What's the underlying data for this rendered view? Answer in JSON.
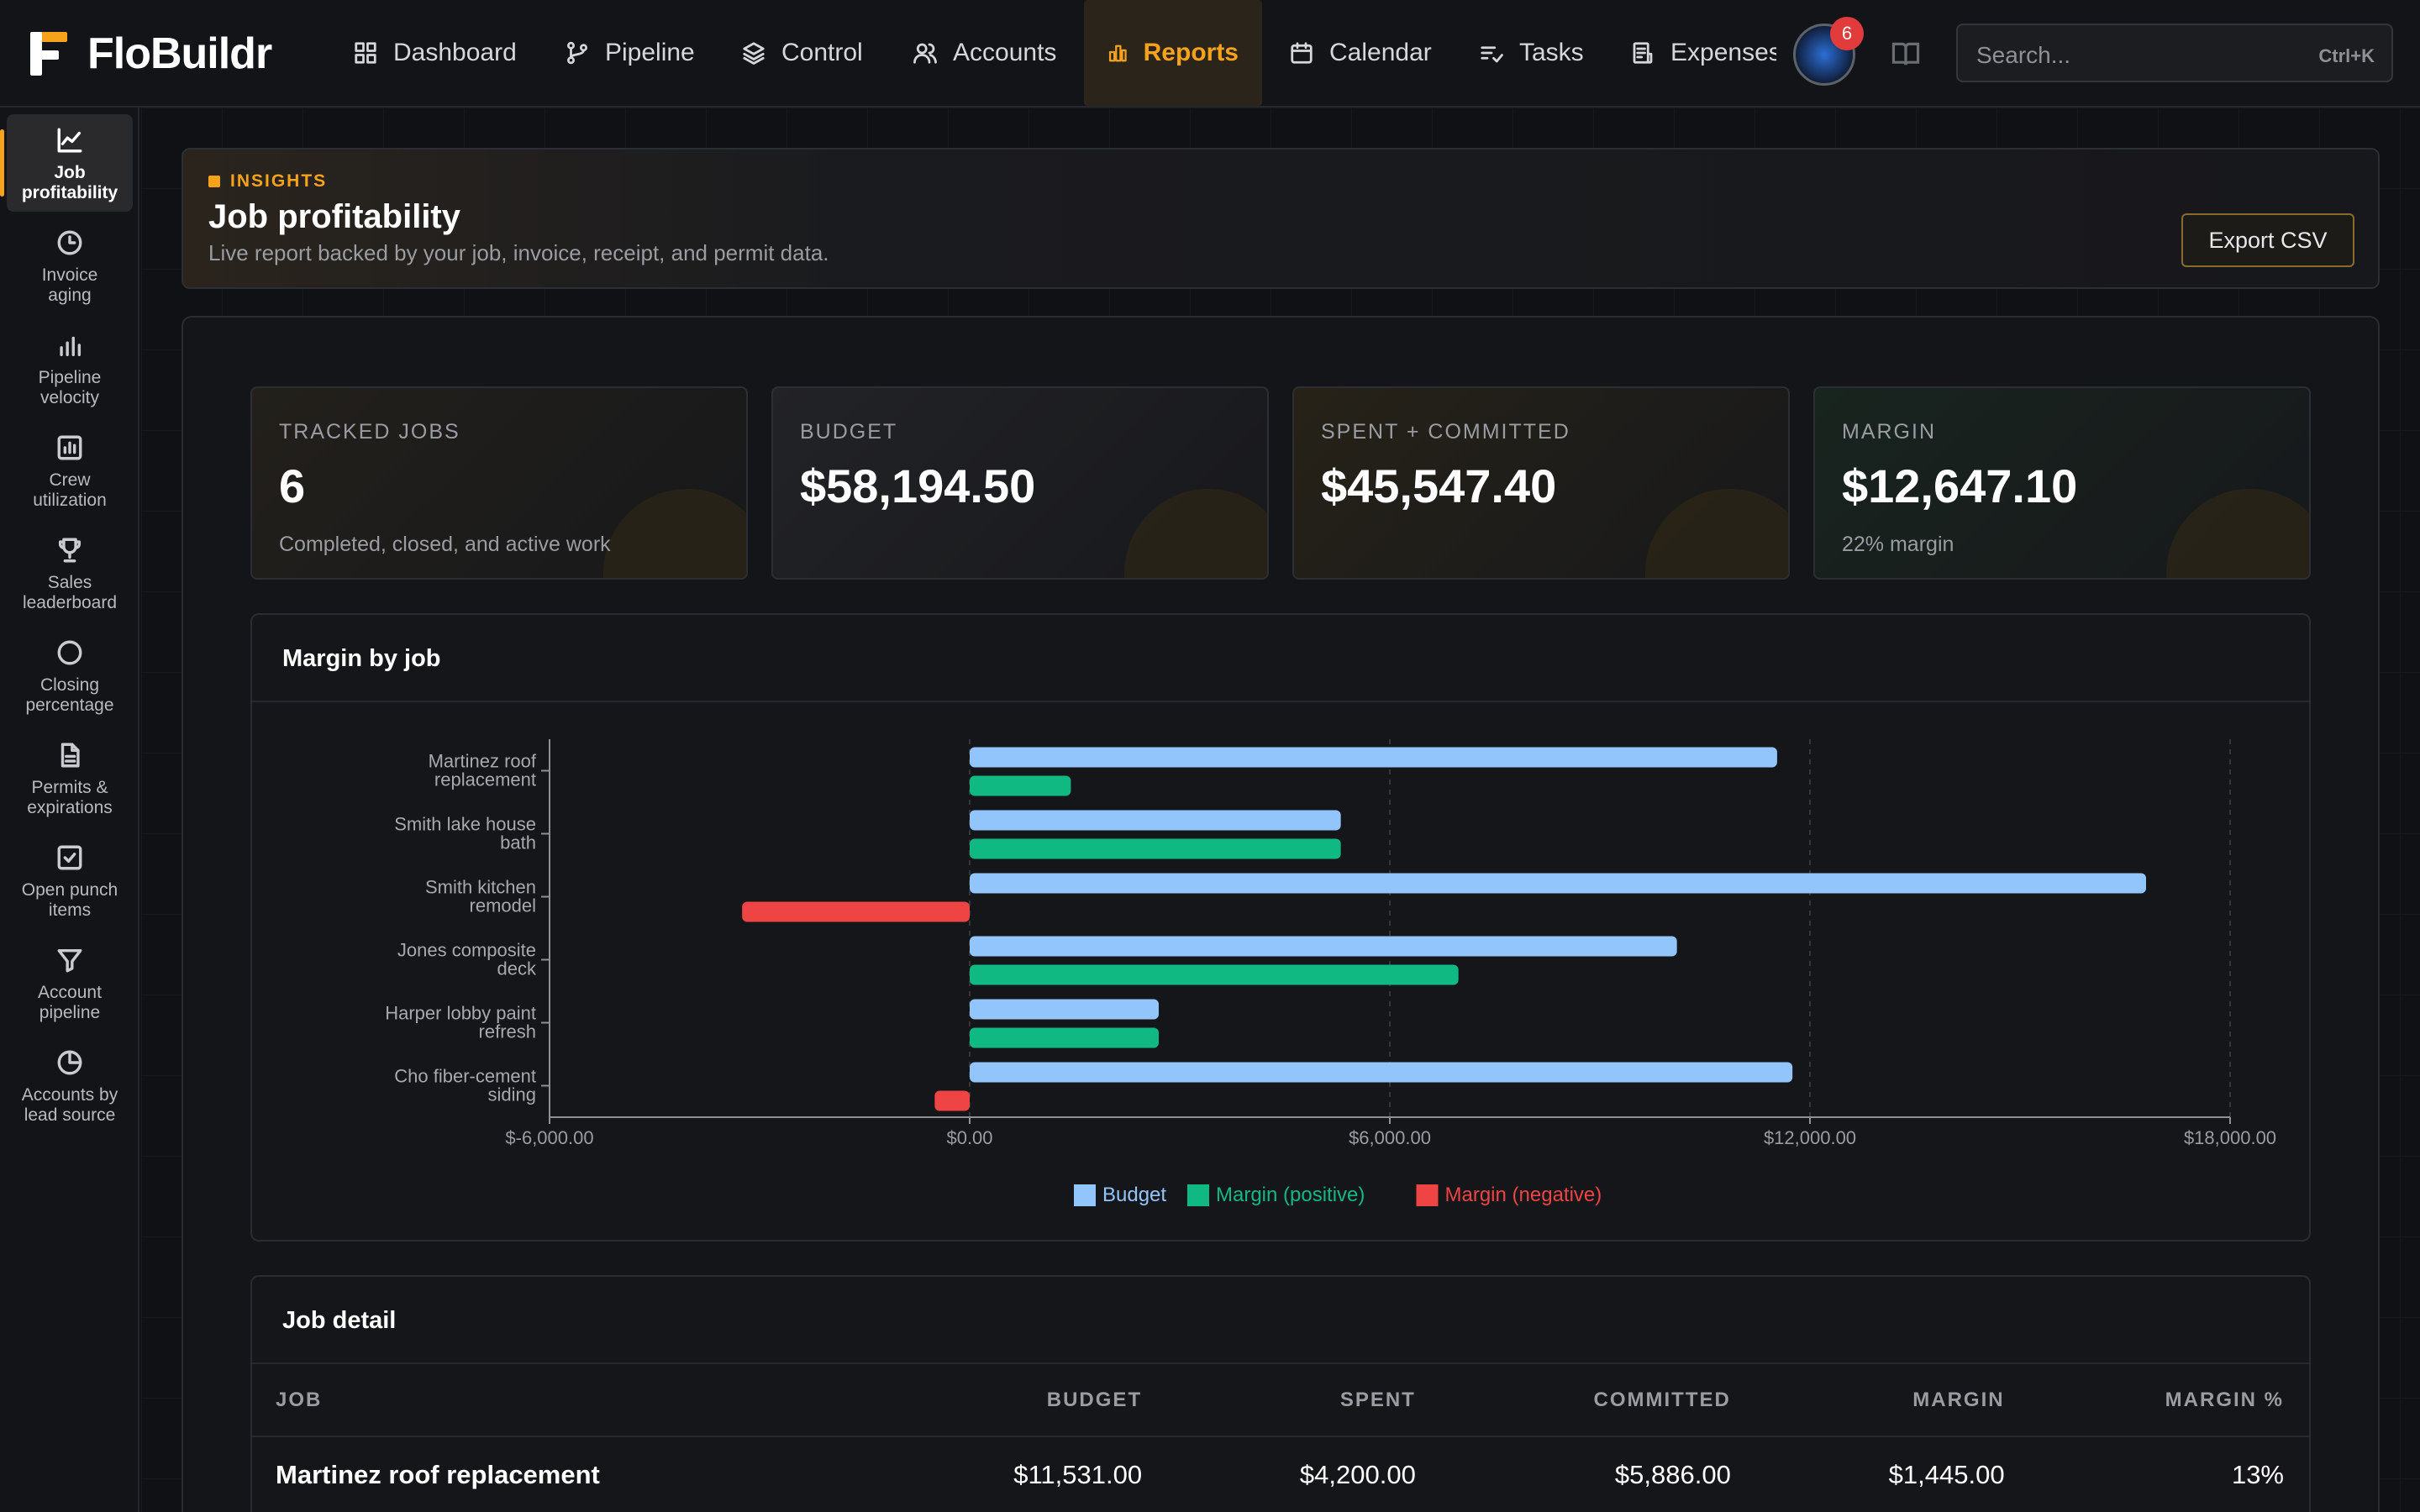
{
  "app": {
    "brand": "FloBuildr"
  },
  "nav": [
    {
      "label": "Dashboard",
      "icon": "grid-icon"
    },
    {
      "label": "Pipeline",
      "icon": "branch-icon"
    },
    {
      "label": "Control",
      "icon": "layers-icon"
    },
    {
      "label": "Accounts",
      "icon": "users-icon"
    },
    {
      "label": "Reports",
      "icon": "bar-chart-icon",
      "active": true
    },
    {
      "label": "Calendar",
      "icon": "calendar-icon"
    },
    {
      "label": "Tasks",
      "icon": "list-check-icon"
    },
    {
      "label": "Expenses",
      "icon": "receipt-icon"
    }
  ],
  "notifications": {
    "count": "6"
  },
  "search": {
    "placeholder": "Search...",
    "shortcut": "Ctrl+K"
  },
  "sidebar": [
    {
      "label_1": "Job",
      "label_2": "profitability",
      "icon": "line-chart-icon",
      "active": true
    },
    {
      "label_1": "Invoice",
      "label_2": "aging",
      "icon": "clock-icon"
    },
    {
      "label_1": "Pipeline",
      "label_2": "velocity",
      "icon": "bars-icon"
    },
    {
      "label_1": "Crew",
      "label_2": "utilization",
      "icon": "chart-box-icon"
    },
    {
      "label_1": "Sales",
      "label_2": "leaderboard",
      "icon": "trophy-icon"
    },
    {
      "label_1": "Closing",
      "label_2": "percentage",
      "icon": "circle-icon"
    },
    {
      "label_1": "Permits &",
      "label_2": "expirations",
      "icon": "document-icon"
    },
    {
      "label_1": "Open punch",
      "label_2": "items",
      "icon": "checkbox-icon"
    },
    {
      "label_1": "Account",
      "label_2": "pipeline",
      "icon": "funnel-icon"
    },
    {
      "label_1": "Accounts by",
      "label_2": "lead source",
      "icon": "pie-icon"
    }
  ],
  "header": {
    "eyebrow": "INSIGHTS",
    "title": "Job profitability",
    "subtitle": "Live report backed by your job, invoice, receipt, and permit data.",
    "export_label": "Export CSV"
  },
  "kpis": [
    {
      "label": "TRACKED JOBS",
      "value": "6",
      "note": "Completed, closed, and active work"
    },
    {
      "label": "BUDGET",
      "value": "$58,194.50",
      "note": ""
    },
    {
      "label": "SPENT + COMMITTED",
      "value": "$45,547.40",
      "note": ""
    },
    {
      "label": "MARGIN",
      "value": "$12,647.10",
      "note": "22% margin"
    }
  ],
  "chart_card": {
    "title": "Margin by job"
  },
  "chart_data": {
    "type": "bar",
    "orientation": "horizontal",
    "categories": [
      [
        "Martinez roof",
        "replacement"
      ],
      [
        "Smith lake house",
        "bath"
      ],
      [
        "Smith kitchen",
        "remodel"
      ],
      [
        "Jones composite",
        "deck"
      ],
      [
        "Harper lobby paint",
        "refresh"
      ],
      [
        "Cho fiber-cement",
        "siding"
      ]
    ],
    "series": [
      {
        "name": "Budget",
        "color": "#93c5fd",
        "values": [
          11531,
          5300,
          16800,
          10100,
          2700,
          11750
        ]
      },
      {
        "name": "Margin",
        "values": [
          1445,
          5300,
          -3250,
          6980,
          2700,
          -500
        ]
      }
    ],
    "legend": [
      {
        "label": "Budget",
        "color": "#93c5fd"
      },
      {
        "label": "Margin (positive)",
        "color": "#10b981"
      },
      {
        "label": "Margin (negative)",
        "color": "#ef4444"
      }
    ],
    "xlim": [
      -6000,
      18000
    ],
    "xticks": [
      {
        "value": -6000,
        "label": "$-6,000.00"
      },
      {
        "value": 0,
        "label": "$0.00"
      },
      {
        "value": 6000,
        "label": "$6,000.00"
      },
      {
        "value": 12000,
        "label": "$12,000.00"
      },
      {
        "value": 18000,
        "label": "$18,000.00"
      }
    ],
    "grid": "vertical dashed",
    "legend_position": "bottom"
  },
  "table": {
    "title": "Job detail",
    "columns": [
      "JOB",
      "BUDGET",
      "SPENT",
      "COMMITTED",
      "MARGIN",
      "MARGIN %"
    ],
    "rows": [
      [
        "Martinez roof replacement",
        "$11,531.00",
        "$4,200.00",
        "$5,886.00",
        "$1,445.00",
        "13%"
      ]
    ]
  },
  "colors": {
    "accent": "#f7a21b",
    "budget": "#93c5fd",
    "positive": "#10b981",
    "negative": "#ef4444"
  }
}
